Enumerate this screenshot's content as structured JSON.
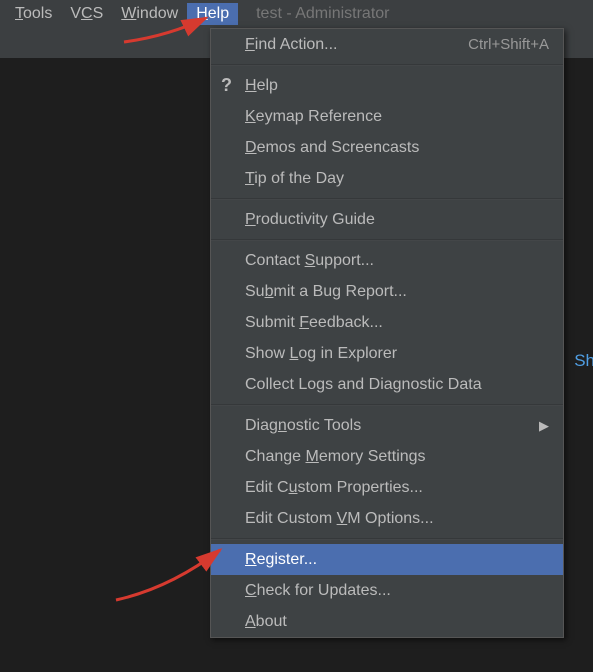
{
  "menubar": {
    "items": [
      {
        "pre": "",
        "u": "T",
        "post": "ools"
      },
      {
        "pre": "V",
        "u": "C",
        "post": "S"
      },
      {
        "pre": "",
        "u": "W",
        "post": "indow"
      },
      {
        "pre": "",
        "u": "H",
        "post": "elp"
      }
    ],
    "open_index": 3,
    "title": "test - Administrator"
  },
  "dropdown": {
    "rows": [
      {
        "pre": "",
        "u": "F",
        "post": "ind Action...",
        "shortcut": "Ctrl+Shift+A",
        "icon": null,
        "submenu": false,
        "selected": false
      },
      {
        "sep": true
      },
      {
        "pre": "",
        "u": "H",
        "post": "elp",
        "icon": "help",
        "submenu": false,
        "selected": false
      },
      {
        "pre": "",
        "u": "K",
        "post": "eymap Reference",
        "submenu": false,
        "selected": false
      },
      {
        "pre": "",
        "u": "D",
        "post": "emos and Screencasts",
        "submenu": false,
        "selected": false
      },
      {
        "pre": "",
        "u": "T",
        "post": "ip of the Day",
        "submenu": false,
        "selected": false
      },
      {
        "sep": true
      },
      {
        "pre": "",
        "u": "P",
        "post": "roductivity Guide",
        "submenu": false,
        "selected": false
      },
      {
        "sep": true
      },
      {
        "pre": "Contact ",
        "u": "S",
        "post": "upport...",
        "submenu": false,
        "selected": false
      },
      {
        "pre": "Su",
        "u": "b",
        "post": "mit a Bug Report...",
        "submenu": false,
        "selected": false
      },
      {
        "pre": "Submit ",
        "u": "F",
        "post": "eedback...",
        "submenu": false,
        "selected": false
      },
      {
        "pre": "Show ",
        "u": "L",
        "post": "og in Explorer",
        "submenu": false,
        "selected": false
      },
      {
        "pre": "Collect Lo",
        "u": "g",
        "post": "s and Diagnostic Data",
        "submenu": false,
        "selected": false
      },
      {
        "sep": true
      },
      {
        "pre": "Diag",
        "u": "n",
        "post": "ostic Tools",
        "submenu": true,
        "selected": false
      },
      {
        "pre": "Change ",
        "u": "M",
        "post": "emory Settings",
        "submenu": false,
        "selected": false
      },
      {
        "pre": "Edit C",
        "u": "u",
        "post": "stom Properties...",
        "submenu": false,
        "selected": false
      },
      {
        "pre": "Edit Custom ",
        "u": "V",
        "post": "M Options...",
        "submenu": false,
        "selected": false
      },
      {
        "sep": true
      },
      {
        "pre": "",
        "u": "R",
        "post": "egister...",
        "submenu": false,
        "selected": true
      },
      {
        "pre": "",
        "u": "C",
        "post": "heck for Updates...",
        "submenu": false,
        "selected": false
      },
      {
        "pre": "",
        "u": "A",
        "post": "bout",
        "submenu": false,
        "selected": false
      }
    ]
  },
  "side": {
    "partial_text": "Sh"
  },
  "colors": {
    "accent": "#4b6eaf",
    "arrow": "#d63a2f"
  }
}
